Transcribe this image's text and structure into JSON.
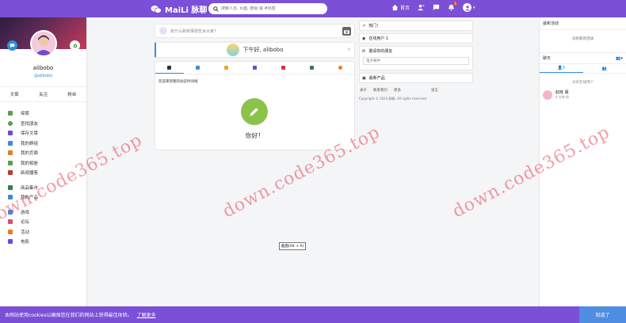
{
  "header": {
    "logo": "MaiLi 脉聊",
    "search_placeholder": "搜索人员, 页面, 群组 或 #标签",
    "home_label": "首页",
    "notification_count": "1"
  },
  "profile": {
    "name": "alibobo",
    "handle": "@alibobo",
    "tabs": [
      "文章",
      "关注",
      "粉丝"
    ]
  },
  "menu": [
    {
      "label": "探索",
      "color": "#5aa04a"
    },
    {
      "label": "查找朋友",
      "color": "#5aa04a"
    },
    {
      "label": "保存文章",
      "color": "#6b4dd4"
    },
    {
      "label": "我的群组",
      "color": "#3a8dd9"
    },
    {
      "label": "我的页面",
      "color": "#e67e22"
    },
    {
      "label": "我的相册",
      "color": "#5aa04a"
    },
    {
      "label": "新闻播客",
      "color": "#c0392b"
    },
    {
      "label": "商品集市",
      "color": "#3a7a52"
    },
    {
      "label": "我的产品",
      "color": "#3a8dd9"
    },
    {
      "label": "游戏",
      "color": "#3a8dd9"
    },
    {
      "label": "论坛",
      "color": "#d35473"
    },
    {
      "label": "活动",
      "color": "#e67e22"
    },
    {
      "label": "电影",
      "color": "#6b4dd4"
    }
  ],
  "composer": {
    "placeholder": "有什么新鲜事想告诉大家?",
    "greeting": "下午好, alibobo"
  },
  "feed": {
    "hint": "欢迎来到我的动态时间线",
    "empty_text": "你好！"
  },
  "right_widgets": {
    "trending": "热门!",
    "online_users": "在线用户 1",
    "invite_friends": "邀请你的朋友",
    "email_placeholder": "电子邮件",
    "latest_products": "最新产品",
    "footer_links": [
      "关于",
      "联系我们",
      "更多",
      "语言"
    ],
    "copyright": "Copyright © 2024 脉聊. All rights reserved."
  },
  "activity_panel": {
    "title": "最新活动",
    "empty": "没有新的活动",
    "chat_title": "聊天",
    "online_count": "0",
    "no_online": "没有在线用户",
    "friend_name": "赵晓 晨",
    "friend_time": "4 分钟 前"
  },
  "tooltip": "截图(Alt + A)",
  "cookie": {
    "text": "本网站使用cookies以确保您在我们的网站上获得最佳体验。",
    "learn_more": "了解更多",
    "accept": "知道了"
  },
  "watermark": "down.code365.top",
  "colors": {
    "brand": "#7b4fd6",
    "accent": "#3a8dd9",
    "accept": "#4f8de0"
  }
}
